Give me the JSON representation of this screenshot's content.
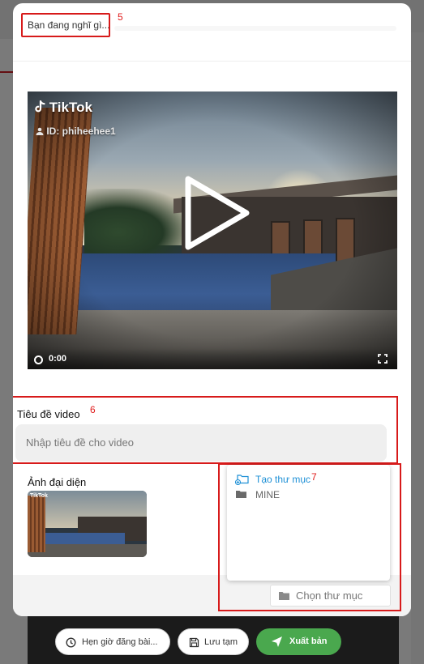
{
  "composer": {
    "thought_placeholder": "Bạn đang nghĩ gì...",
    "annotation_5": "5"
  },
  "video": {
    "brand": "TikTok",
    "user_id": "ID: phiheehee1",
    "time": "0:00"
  },
  "title_section": {
    "label": "Tiêu đề video",
    "placeholder": "Nhập tiêu đề cho video",
    "annotation_6": "6"
  },
  "thumbnail": {
    "label": "Ảnh đại diện",
    "brand": "TikTok"
  },
  "folder_dropdown": {
    "create_label": "Tạo thư mục",
    "annotation_7": "7",
    "folders": [
      "MINE"
    ],
    "choose_label": "Chọn thư mục"
  },
  "actions": {
    "schedule_label": "Hẹn giờ đăng bài...",
    "draft_label": "Lưu tạm",
    "publish_label": "Xuất bản"
  },
  "colors": {
    "highlight": "#d71a1a",
    "publish": "#4aa84e",
    "link": "#1e90d6"
  }
}
